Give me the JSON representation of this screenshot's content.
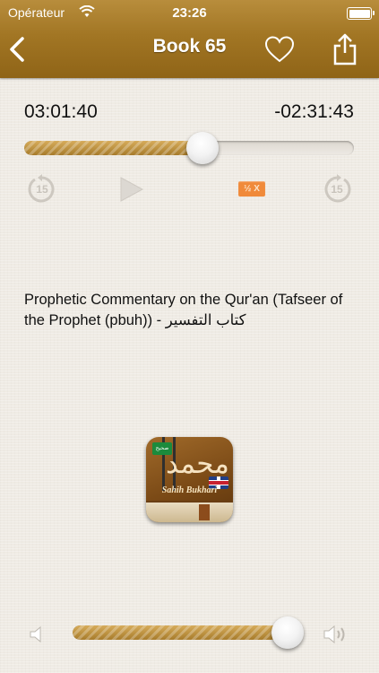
{
  "status_bar": {
    "carrier": "Opérateur",
    "time": "23:26",
    "wifi_icon": "wifi-icon",
    "battery_icon": "battery-icon"
  },
  "nav": {
    "title": "Book 65",
    "back_icon": "chevron-left-icon",
    "favorite_icon": "heart-icon",
    "share_icon": "share-icon"
  },
  "player": {
    "elapsed": "03:01:40",
    "remaining": "-02:31:43",
    "progress": 0.54,
    "rewind_seconds": "15",
    "forward_seconds": "15",
    "speed_label": "½ X",
    "accent_color": "#f08a3a"
  },
  "track": {
    "description": "Prophetic Commentary on the Qur'an (Tafseer of the Prophet (pbuh)) - كتاب التفسير"
  },
  "cover": {
    "title": "Sahih Bukhari",
    "logo_text": "محمد",
    "badge_text": "صحيح"
  },
  "volume": {
    "level": 0.94,
    "low_icon": "speaker-low-icon",
    "high_icon": "speaker-high-icon"
  },
  "colors": {
    "header": "#a27624",
    "background": "#efebe4",
    "progress_fill": "#c2954a"
  }
}
